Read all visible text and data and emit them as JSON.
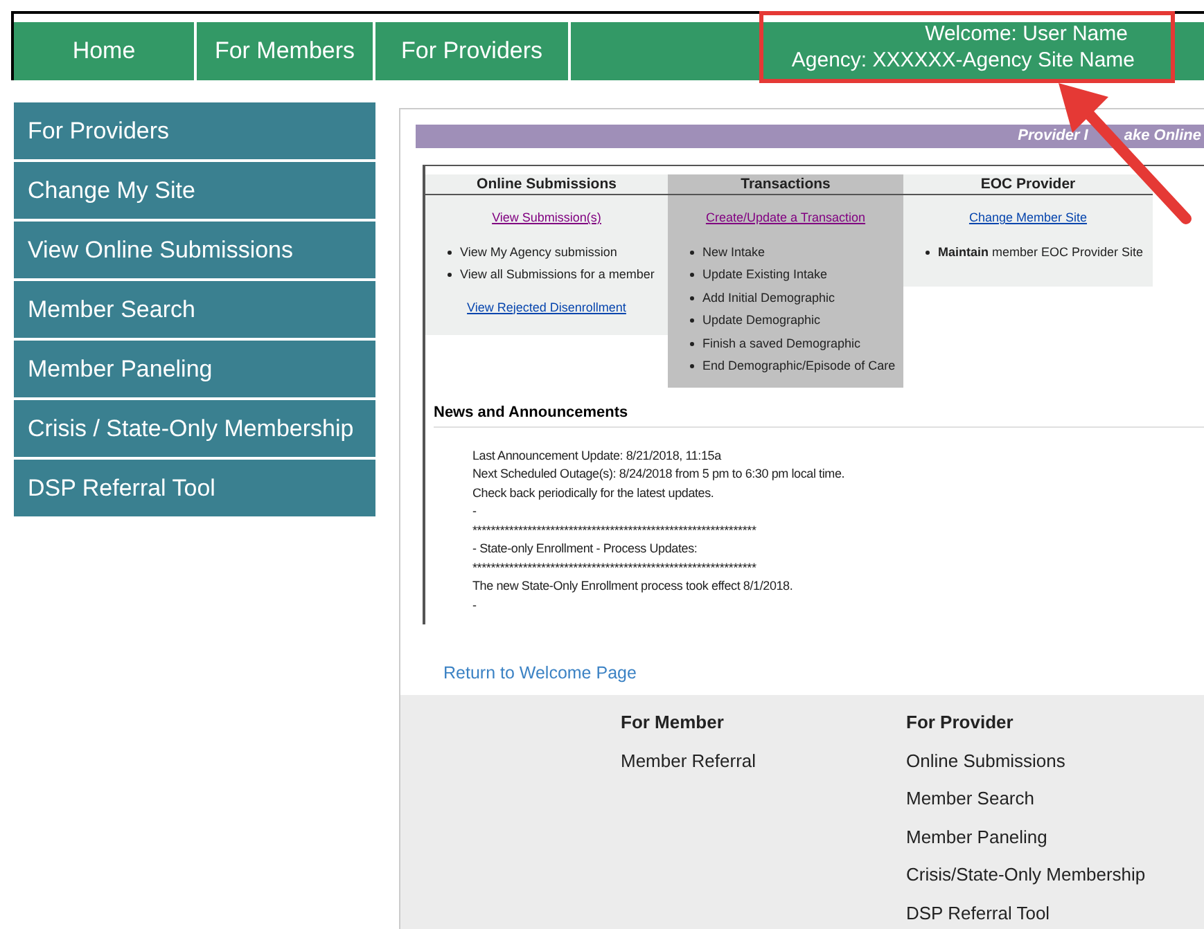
{
  "nav": {
    "tabs": [
      {
        "label": "Home",
        "selected": false
      },
      {
        "label": "For Members",
        "selected": false
      },
      {
        "label": "For Providers",
        "selected": false
      }
    ],
    "welcome": "Welcome: User Name",
    "agency": "Agency: XXXXXX-Agency Site Name"
  },
  "sidebar": {
    "items": [
      "For Providers",
      "Change My Site",
      "View Online Submissions",
      "Member Search",
      "Member Paneling",
      "Crisis / State-Only Membership",
      "DSP Referral Tool"
    ]
  },
  "banner": [
    "Provider I",
    "ake Online"
  ],
  "columns": [
    {
      "heading": "Online Submissions",
      "link": {
        "text": "View Submission(s)",
        "color": "#800080"
      },
      "bullets": [
        "View My Agency submission",
        "View all Submissions for a member"
      ],
      "extra_link": {
        "text": "View Rejected Disenrollment",
        "color": "#0645ad"
      },
      "color": "#eef0ef"
    },
    {
      "heading": "Transactions",
      "link": {
        "text": "Create/Update a Transaction",
        "color": "#800080"
      },
      "bullets": [
        "New Intake",
        "Update Existing Intake",
        "Add Initial Demographic",
        "Update Demographic",
        "Finish a saved Demographic",
        "End Demographic/Episode of Care"
      ],
      "color": "#c0c0c0"
    },
    {
      "heading": "EOC Provider",
      "link": {
        "text": "Change Member Site",
        "color": "#0645ad"
      },
      "bullets": [
        "**Maintain** member EOC Provider Site"
      ],
      "color": "#eef0ef"
    }
  ],
  "news": {
    "title": "News and Announcements",
    "lines": [
      "Last Announcement Update: 8/21/2018, 11:15a",
      "Next Scheduled Outage(s): 8/24/2018 from 5 pm to 6:30 pm local time.",
      "Check back periodically for the latest updates.",
      "-",
      "**************************************************************",
      "- State-only Enrollment - Process Updates:",
      "**************************************************************",
      "The new State-Only Enrollment process took effect 8/1/2018.",
      "-"
    ]
  },
  "return_link": "Return to Welcome Page",
  "footer": [
    {
      "heading": "For Member",
      "links": [
        "Member Referral"
      ]
    },
    {
      "heading": "For Provider",
      "links": [
        "Online Submissions",
        "Member Search",
        "Member Paneling",
        "Crisis/State-Only Membership",
        "DSP Referral Tool"
      ]
    }
  ]
}
